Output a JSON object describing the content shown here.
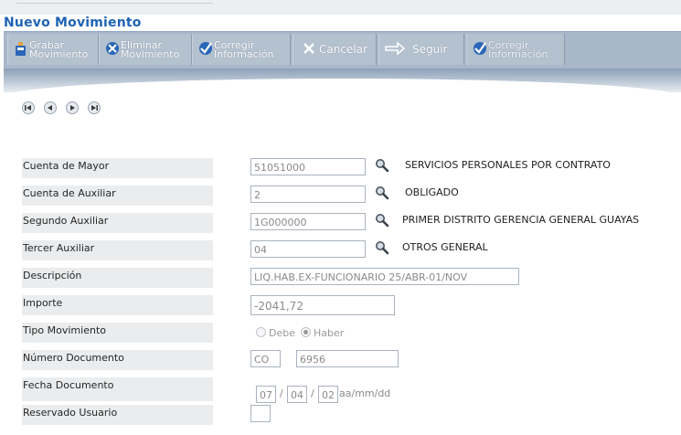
{
  "title": "Nuevo Movimiento",
  "toolbar": {
    "grabar": "Grabar\nMovimiento",
    "eliminar": "Eliminar\nMovimiento",
    "corregir1": "Corregir\nInformación",
    "cancelar": "Cancelar",
    "seguir": "Seguir",
    "corregir2": "Corregir\nInformación"
  },
  "form": {
    "cuenta_mayor": {
      "label": "Cuenta de Mayor",
      "value": "51051000",
      "desc": "SERVICIOS PERSONALES POR CONTRATO"
    },
    "cuenta_auxiliar": {
      "label": "Cuenta de Auxiliar",
      "value": "2",
      "desc": "OBLIGADO"
    },
    "segundo_auxiliar": {
      "label": "Segundo Auxiliar",
      "value": "1G000000",
      "desc": "PRIMER DISTRITO GERENCIA GENERAL GUAYAS"
    },
    "tercer_auxiliar": {
      "label": "Tercer Auxiliar",
      "value": "04",
      "desc": "OTROS GENERAL"
    },
    "descripcion": {
      "label": "Descripción",
      "value": "LIQ.HAB.EX-FUNCIONARIO 25/ABR-01/NOV"
    },
    "importe": {
      "label": "Importe",
      "value": "-2041,72"
    },
    "tipo_movimiento": {
      "label": "Tipo Movimiento",
      "debe": "Debe",
      "haber": "Haber",
      "selected": "Haber"
    },
    "numero_documento": {
      "label": "Número Documento",
      "prefix": "CO",
      "number": "6956"
    },
    "fecha_documento": {
      "label": "Fecha Documento",
      "yy": "07",
      "mm": "04",
      "dd": "02",
      "sep": "/",
      "format": "aa/mm/dd"
    },
    "reservado_usuario": {
      "label": "Reservado Usuario",
      "value": ""
    }
  },
  "icons": {
    "nav": [
      "first-record-icon",
      "previous-record-icon",
      "next-record-icon",
      "last-record-icon"
    ],
    "lookup": "magnifier-icon"
  },
  "colors": {
    "title": "#1f62b5",
    "toolbar": "#a8b7c9",
    "label_bg": "#eaecee"
  }
}
